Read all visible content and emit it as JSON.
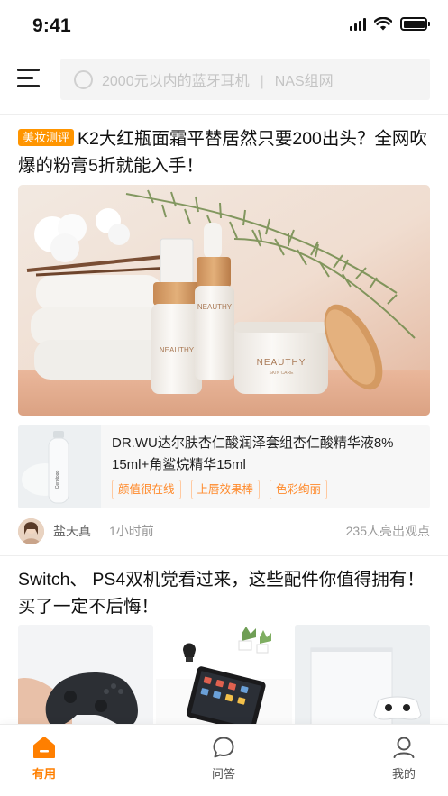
{
  "status_bar": {
    "time": "9:41"
  },
  "header": {
    "search": {
      "hint_1": "2000元以内的蓝牙耳机",
      "separator": "|",
      "hint_2": "NAS组网"
    }
  },
  "feed": [
    {
      "tag": "美妆测评",
      "title": "K2大红瓶面霜平替居然只要200出头？全网吹爆的粉膏5折就能入手！",
      "product": {
        "name": "DR.WU达尔肤杏仁酸润泽套组杏仁酸精华液8% 15ml+角鲨烷精华15ml",
        "tags": [
          "颜值很在线",
          "上唇效果棒",
          "色彩绚丽"
        ],
        "thumb_text": "Cerotogo"
      },
      "image_text": {
        "brand": "NEAUTHY",
        "sub": "SKIN CARE"
      },
      "author": "盐天真",
      "time": "1小时前",
      "opinions": "235人亮出观点"
    },
    {
      "title": "Switch、 PS4双机党看过来，这些配件你值得拥有！买了一定不后悔！"
    }
  ],
  "tabbar": {
    "items": [
      {
        "label": "有用",
        "active": true,
        "icon": "home-icon"
      },
      {
        "label": "问答",
        "active": false,
        "icon": "chat-bubble-icon"
      },
      {
        "label": "我的",
        "active": false,
        "icon": "user-icon"
      }
    ]
  },
  "colors": {
    "accent": "#ff7f00",
    "tag_bg": "#ff9500"
  }
}
